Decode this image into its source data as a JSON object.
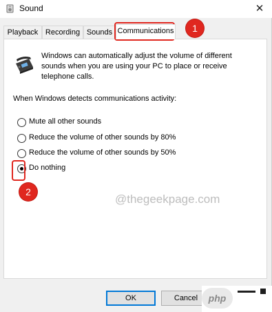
{
  "window": {
    "title": "Sound",
    "close_glyph": "✕",
    "icon": "speaker-icon"
  },
  "tabs": [
    {
      "label": "Playback",
      "active": false
    },
    {
      "label": "Recording",
      "active": false
    },
    {
      "label": "Sounds",
      "active": false
    },
    {
      "label": "Communications",
      "active": true
    }
  ],
  "panel": {
    "icon": "telephone-icon",
    "description": "Windows can automatically adjust the volume of different sounds when you are using your PC to place or receive telephone calls.",
    "subheading": "When Windows detects communications activity:",
    "options": [
      {
        "label": "Mute all other sounds",
        "checked": false
      },
      {
        "label": "Reduce the volume of other sounds by 80%",
        "checked": false
      },
      {
        "label": "Reduce the volume of other sounds by 50%",
        "checked": false
      },
      {
        "label": "Do nothing",
        "checked": true
      }
    ]
  },
  "buttons": {
    "ok": "OK",
    "cancel": "Cancel"
  },
  "watermark": "@thegeekpage.com",
  "annotations": {
    "step1": "1",
    "step2": "2",
    "color": "#e0271f"
  },
  "php_badge": {
    "label": "php"
  }
}
